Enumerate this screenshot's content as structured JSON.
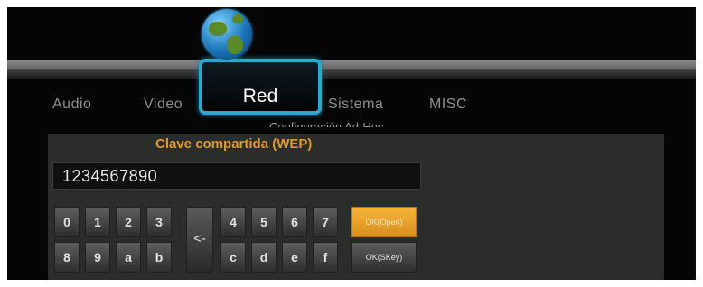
{
  "menu": {
    "tabs": [
      {
        "label": "Audio"
      },
      {
        "label": "Video"
      },
      {
        "label": "Red"
      },
      {
        "label": "Sistema"
      },
      {
        "label": "MISC"
      }
    ],
    "active_index": 2,
    "subtitle": "Configuración Ad-Hoc"
  },
  "dialog": {
    "title": "Clave compartida (WEP)",
    "input_value": "1234567890"
  },
  "keyboard": {
    "row1": [
      "0",
      "1",
      "2",
      "3"
    ],
    "row1b": [
      "4",
      "5",
      "6",
      "7"
    ],
    "row2": [
      "8",
      "9",
      "a",
      "b"
    ],
    "row2b": [
      "c",
      "d",
      "e",
      "f"
    ],
    "backspace": "<-",
    "ok_open": "OK(Open)",
    "ok_skey": "OK(SKey)"
  },
  "colors": {
    "accent_blue": "#2aa8cf",
    "title_orange": "#e0982e",
    "focus_orange": "#f0a62c"
  },
  "icons": {
    "network": "globe-icon"
  }
}
